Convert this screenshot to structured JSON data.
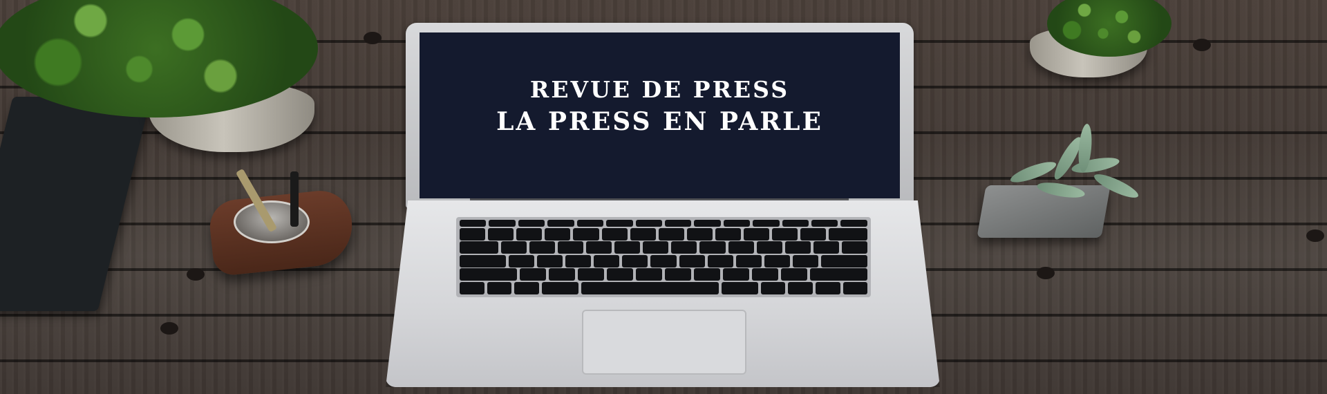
{
  "screen": {
    "line1": "REVUE DE PRESS",
    "line2": "LA PRESS EN PARLE"
  },
  "colors": {
    "screen_background": "#141a2e",
    "screen_text": "#ffffff",
    "desk_wood": "#433a35"
  }
}
